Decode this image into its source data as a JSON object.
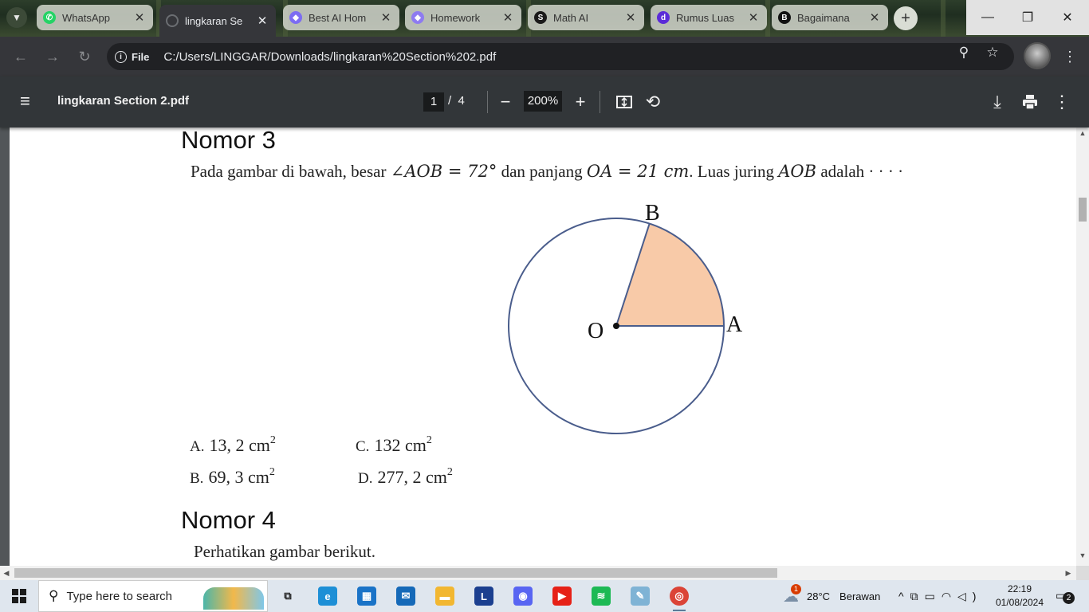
{
  "tabs": [
    {
      "title": "WhatsApp",
      "icon": "whatsapp-icon",
      "color": "#25d366",
      "glyph": "✆",
      "active": false
    },
    {
      "title": "lingkaran Se",
      "icon": "pdf-loading-icon",
      "color": "#35363a",
      "glyph": "",
      "active": true
    },
    {
      "title": "Best AI Hom",
      "icon": "gem-icon",
      "color": "#7c6cf2",
      "glyph": "◆",
      "active": false
    },
    {
      "title": "Homework",
      "icon": "gem-icon",
      "color": "#8e7bf0",
      "glyph": "◆",
      "active": false
    },
    {
      "title": "Math AI",
      "icon": "mathai-icon",
      "color": "#1a1a1a",
      "glyph": "S",
      "active": false
    },
    {
      "title": "Rumus Luas",
      "icon": "d-icon",
      "color": "#5b2bd8",
      "glyph": "d",
      "active": false
    },
    {
      "title": "Bagaimana",
      "icon": "b-icon",
      "color": "#111111",
      "glyph": "B",
      "active": false
    }
  ],
  "address": {
    "chip_label": "File",
    "url": "C:/Users/LINGGAR/Downloads/lingkaran%20Section%202.pdf"
  },
  "pdf": {
    "filename": "lingkaran Section 2.pdf",
    "current_page": "1",
    "total_pages": "4",
    "zoom": "200%"
  },
  "document": {
    "q3_heading": "Nomor 3",
    "q3_text_1": "Pada gambar di bawah, besar ",
    "q3_angle": "∠AOB = 72°",
    "q3_text_2": " dan panjang ",
    "q3_length": "OA = 21 cm",
    "q3_text_3": ". Luas juring ",
    "q3_sector": "AOB",
    "q3_text_4": " adalah · · · ·",
    "diagram": {
      "label_b": "B",
      "label_o": "O",
      "label_a": "A",
      "sector_color": "#f8caa8",
      "circle_color": "#4a5d8c"
    },
    "options": [
      {
        "label": "A.",
        "value": "13, 2 cm",
        "exp": "2"
      },
      {
        "label": "C.",
        "value": "132 cm",
        "exp": "2"
      },
      {
        "label": "B.",
        "value": "69, 3 cm",
        "exp": "2"
      },
      {
        "label": "D.",
        "value": "277, 2 cm",
        "exp": "2"
      }
    ],
    "q4_heading": "Nomor 4",
    "q4_text": "Perhatikan gambar berikut."
  },
  "taskbar": {
    "search_placeholder": "Type here to search",
    "weather_temp": "28°C",
    "weather_desc": "Berawan",
    "weather_badge": "1",
    "time": "22:19",
    "date": "01/08/2024",
    "notification_count": "2",
    "apps": [
      {
        "name": "task-view-icon",
        "color": "#1b1b1b",
        "glyph": "⧉"
      },
      {
        "name": "edge-icon",
        "color": "#1d8fd6",
        "glyph": "e"
      },
      {
        "name": "store-icon",
        "color": "#1a73c7",
        "glyph": "▦"
      },
      {
        "name": "mail-icon",
        "color": "#1569b8",
        "glyph": "✉"
      },
      {
        "name": "file-explorer-icon",
        "color": "#f2b731",
        "glyph": "▬"
      },
      {
        "name": "l-app-icon",
        "color": "#1b3f8f",
        "glyph": "L"
      },
      {
        "name": "discord-icon",
        "color": "#5865f2",
        "glyph": "◉"
      },
      {
        "name": "youtube-music-icon",
        "color": "#e62117",
        "glyph": "▶"
      },
      {
        "name": "spotify-icon",
        "color": "#1db954",
        "glyph": "≋"
      },
      {
        "name": "notepad-icon",
        "color": "#7fb3d5",
        "glyph": "✎"
      },
      {
        "name": "chrome-icon",
        "color": "#db4437",
        "glyph": "◎"
      }
    ]
  }
}
